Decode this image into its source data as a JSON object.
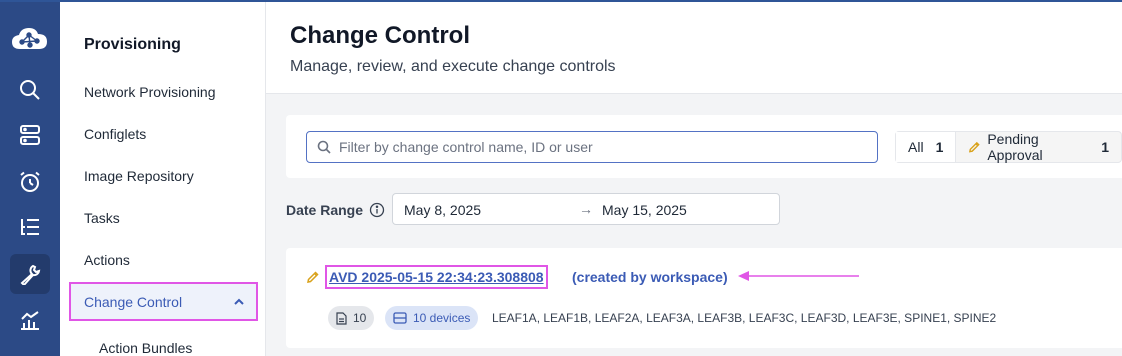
{
  "sidebar": {
    "section_title": "Provisioning",
    "items": [
      {
        "label": "Network Provisioning"
      },
      {
        "label": "Configlets"
      },
      {
        "label": "Image Repository"
      },
      {
        "label": "Tasks"
      },
      {
        "label": "Actions"
      },
      {
        "label": "Change Control"
      }
    ],
    "sub_items": [
      {
        "label": "Action Bundles"
      }
    ]
  },
  "rail": {
    "icons": [
      "cloud-logo-icon",
      "search-icon",
      "devices-icon",
      "events-alarm-icon",
      "workspace-list-icon",
      "provisioning-wrench-icon",
      "dashboard-chart-icon"
    ],
    "accent": "#2c4a86"
  },
  "header": {
    "title": "Change Control",
    "subtitle": "Manage, review, and execute change controls"
  },
  "filter": {
    "search_placeholder": "Filter by change control name, ID or user",
    "tabs": [
      {
        "label": "All",
        "count": "1"
      },
      {
        "label": "Pending Approval",
        "count": "1"
      }
    ]
  },
  "date_range": {
    "label": "Date Range",
    "start": "May 8, 2025",
    "arrow": "→",
    "end": "May 15, 2025"
  },
  "change_control": {
    "name": "AVD 2025-05-15 22:34:23.308808",
    "created_by": "(created by workspace)",
    "task_count": "10",
    "devices_badge": "10 devices",
    "devices": "LEAF1A, LEAF1B, LEAF2A, LEAF3A, LEAF3B, LEAF3C, LEAF3D, LEAF3E, SPINE1, SPINE2"
  },
  "colors": {
    "highlight": "#e056e6",
    "link": "#3b5bb5"
  }
}
